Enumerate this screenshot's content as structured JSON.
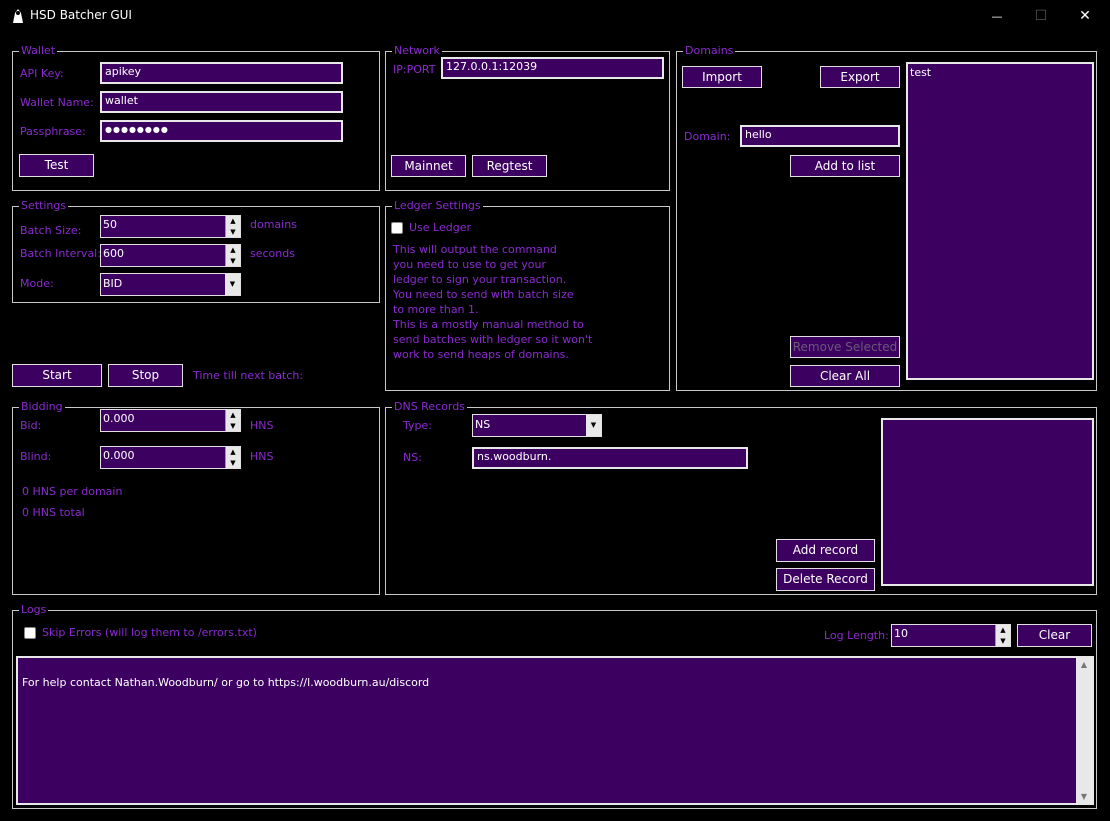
{
  "window": {
    "title": "HSD Batcher GUI",
    "minimize": "—",
    "maximize": "☐",
    "close": "✕"
  },
  "wallet": {
    "legend": "Wallet",
    "api_key_label": "API Key:",
    "api_key_value": "apikey",
    "wallet_name_label": "Wallet Name:",
    "wallet_name_value": "wallet",
    "passphrase_label": "Passphrase:",
    "passphrase_value": "●●●●●●●●",
    "test_button": "Test"
  },
  "network": {
    "legend": "Network",
    "ip_label": "IP:PORT",
    "ip_value": "127.0.0.1:12039",
    "mainnet_button": "Mainnet",
    "regtest_button": "Regtest"
  },
  "domains": {
    "legend": "Domains",
    "import_button": "Import",
    "export_button": "Export",
    "domain_label": "Domain:",
    "domain_value": "hello",
    "add_button": "Add to list",
    "remove_button": "Remove Selected",
    "clear_button": "Clear All",
    "list": [
      "test"
    ]
  },
  "settings": {
    "legend": "Settings",
    "batch_size_label": "Batch Size:",
    "batch_size_value": "50",
    "batch_size_unit": "domains",
    "batch_interval_label": "Batch Interval:",
    "batch_interval_value": "600",
    "batch_interval_unit": "seconds",
    "mode_label": "Mode:",
    "mode_value": "BID"
  },
  "ledger": {
    "legend": "Ledger Settings",
    "use_ledger_label": "Use Ledger",
    "notes": [
      "This will output the command",
      "you need to use to get your",
      "ledger to sign your transaction.",
      "You need to send with batch size",
      "to more than 1.",
      "This is a mostly manual method to",
      "send batches with ledger so it won't",
      "work to send heaps of domains."
    ]
  },
  "controls": {
    "start_button": "Start",
    "stop_button": "Stop",
    "next_batch_label": "Time till next batch:"
  },
  "bidding": {
    "legend": "Bidding",
    "bid_label": "Bid:",
    "bid_value": "0.000",
    "bid_unit": "HNS",
    "blind_label": "Blind:",
    "blind_value": "0.000",
    "blind_unit": "HNS",
    "per_domain": "0 HNS per domain",
    "total": "0 HNS total"
  },
  "dns": {
    "legend": "DNS Records",
    "type_label": "Type:",
    "type_value": "NS",
    "ns_label": "NS:",
    "ns_value": "ns.woodburn.",
    "add_button": "Add record",
    "delete_button": "Delete Record"
  },
  "logs": {
    "legend": "Logs",
    "skip_errors_label": "Skip Errors (will log them to /errors.txt)",
    "log_length_label": "Log Length:",
    "log_length_value": "10",
    "clear_button": "Clear",
    "text": "For help contact Nathan.Woodburn/ or go to https://l.woodburn.au/discord"
  },
  "colors": {
    "accent": "#8a2bd0",
    "field_bg": "#3c0060",
    "background": "#000000"
  }
}
